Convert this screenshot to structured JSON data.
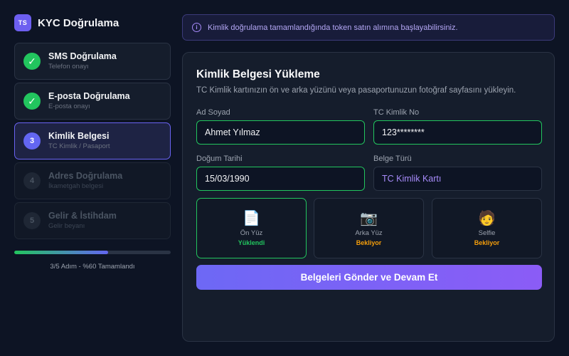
{
  "brand": {
    "logo": "TS",
    "title": "KYC Doğrulama"
  },
  "steps": [
    {
      "title": "SMS Doğrulama",
      "subtitle": "Telefon onayı",
      "status": "done",
      "marker": "✓"
    },
    {
      "title": "E-posta Doğrulama",
      "subtitle": "E-posta onayı",
      "status": "done",
      "marker": "✓"
    },
    {
      "title": "Kimlik Belgesi",
      "subtitle": "TC Kimlik / Pasaport",
      "status": "active",
      "marker": "3"
    },
    {
      "title": "Adres Doğrulama",
      "subtitle": "İkametgah belgesi",
      "status": "pending",
      "marker": "4"
    },
    {
      "title": "Gelir & İstihdam",
      "subtitle": "Gelir beyanı",
      "status": "pending",
      "marker": "5"
    }
  ],
  "progress": {
    "percent": 60,
    "text": "3/5 Adım - %60 Tamamlandı"
  },
  "banner": {
    "icon": "info-icon",
    "text": "Kimlik doğrulama tamamlandığında token satın alımına başlayabilirsiniz."
  },
  "card": {
    "title": "Kimlik Belgesi Yükleme",
    "description": "TC Kimlik kartınızın ön ve arka yüzünü veya pasaportunuzun fotoğraf sayfasını yükleyin."
  },
  "form": {
    "name_label": "Ad Soyad",
    "name_value": "Ahmet Yılmaz",
    "tc_label": "TC Kimlik No",
    "tc_value": "123********",
    "birth_label": "Doğum Tarihi",
    "birth_value": "15/03/1990",
    "doctype_label": "Belge Türü",
    "doctype_value": "TC Kimlik Kartı"
  },
  "uploads": [
    {
      "icon": "📄",
      "icon_name": "document-icon",
      "name": "Ön Yüz",
      "status": "Yüklendi",
      "status_color": "#22c55e"
    },
    {
      "icon": "📷",
      "icon_name": "camera-icon",
      "name": "Arka Yüz",
      "status": "Bekliyor",
      "status_color": "#f59e0b"
    },
    {
      "icon": "🧑",
      "icon_name": "selfie-icon",
      "name": "Selfie",
      "status": "Bekliyor",
      "status_color": "#f59e0b"
    }
  ],
  "submit_label": "Belgeleri Gönder ve Devam Et",
  "colors": {
    "accent": "#6366f1",
    "success": "#22c55e",
    "warning": "#f59e0b",
    "background": "#0d1424"
  }
}
